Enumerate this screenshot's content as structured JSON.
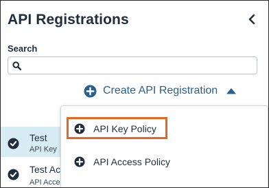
{
  "header": {
    "title": "API Registrations"
  },
  "search": {
    "label": "Search",
    "value": "",
    "placeholder": ""
  },
  "create": {
    "label": "Create API Registration"
  },
  "list": {
    "items": [
      {
        "name": "Test",
        "sub": "API Key"
      },
      {
        "name": "Test Ac",
        "sub": "API Access Policy"
      }
    ]
  },
  "dropdown": {
    "items": [
      {
        "label": "API Key Policy"
      },
      {
        "label": "API Access Policy"
      }
    ]
  },
  "colors": {
    "accent": "#2b5f8d",
    "highlight": "#e8661e",
    "selected_row": "#d8ecf6",
    "text": "#1f2d3d"
  }
}
